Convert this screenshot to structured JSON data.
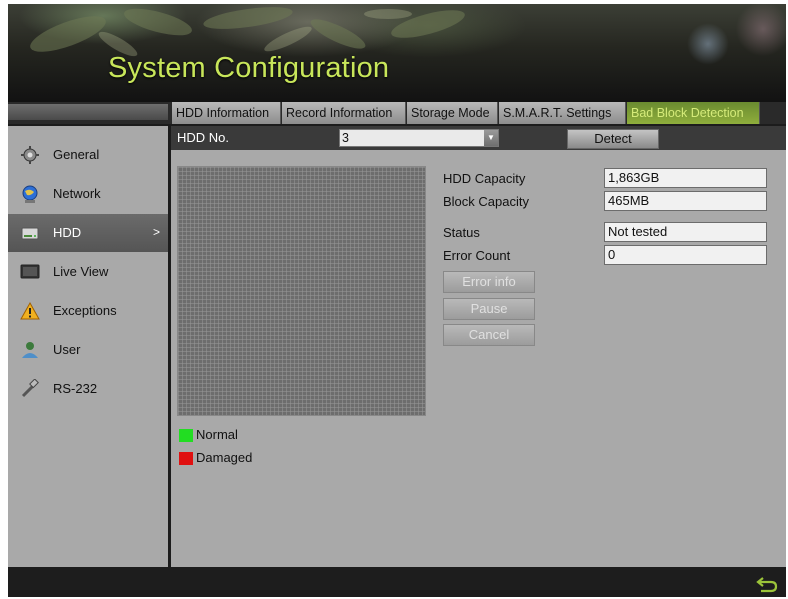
{
  "header": {
    "title": "System Configuration"
  },
  "tabs": [
    {
      "label": "HDD Information",
      "active": false
    },
    {
      "label": "Record Information",
      "active": false
    },
    {
      "label": "Storage Mode",
      "active": false
    },
    {
      "label": "S.M.A.R.T. Settings",
      "active": false
    },
    {
      "label": "Bad Block Detection",
      "active": true
    }
  ],
  "sidebar": {
    "items": [
      {
        "label": "General",
        "icon": "gear-icon"
      },
      {
        "label": "Network",
        "icon": "globe-icon"
      },
      {
        "label": "HDD",
        "icon": "hard-drive-icon",
        "active": true,
        "arrow": ">"
      },
      {
        "label": "Live View",
        "icon": "monitor-icon"
      },
      {
        "label": "Exceptions",
        "icon": "warning-icon"
      },
      {
        "label": "User",
        "icon": "user-icon"
      },
      {
        "label": "RS-232",
        "icon": "serial-port-icon"
      }
    ]
  },
  "main": {
    "hdd_no_label": "HDD No.",
    "hdd_no_value": "3",
    "detect_label": "Detect",
    "fields": {
      "hdd_capacity": {
        "label": "HDD Capacity",
        "value": "1,863GB"
      },
      "block_capacity": {
        "label": "Block Capacity",
        "value": "465MB"
      },
      "status": {
        "label": "Status",
        "value": "Not tested"
      },
      "error_count": {
        "label": "Error Count",
        "value": "0"
      }
    },
    "buttons": {
      "error_info": "Error info",
      "pause": "Pause",
      "cancel": "Cancel"
    },
    "legend": {
      "normal": {
        "label": "Normal",
        "color": "#22dd22"
      },
      "damaged": {
        "label": "Damaged",
        "color": "#e01010"
      }
    }
  },
  "colors": {
    "title": "#c8e65a",
    "active_tab_bg": "#7c9c34",
    "panel_bg": "#a9a9a9"
  },
  "footer": {
    "icon": "return-icon"
  }
}
